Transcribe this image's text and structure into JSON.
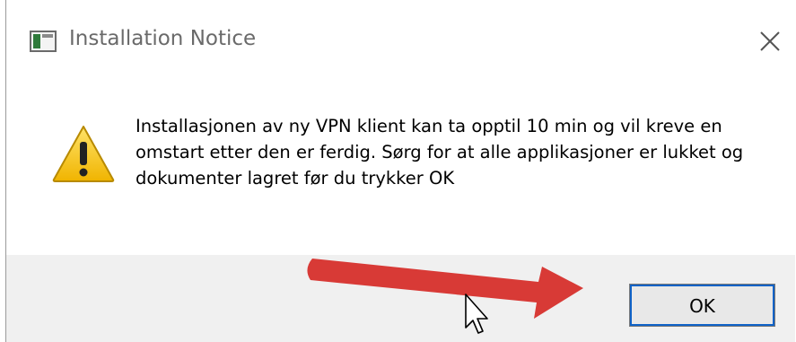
{
  "dialog": {
    "title": "Installation Notice",
    "message": "Installasjonen av ny VPN klient kan ta opptil 10 min og vil kreve en omstart etter den er ferdig. Sørg for at alle applikasjoner er lukket og dokumenter lagret før du trykker OK",
    "ok_label": "OK",
    "icons": {
      "app": "app-icon",
      "close": "close-icon",
      "warning": "warning-icon",
      "cursor": "mouse-cursor-icon",
      "annotation": "red-arrow-annotation"
    }
  },
  "colors": {
    "title_text": "#6a6a6a",
    "footer_bg": "#f0f0f0",
    "focus_outline": "#0f62c7",
    "warning_fill": "#f5c518",
    "annotation_arrow": "#e53935"
  }
}
